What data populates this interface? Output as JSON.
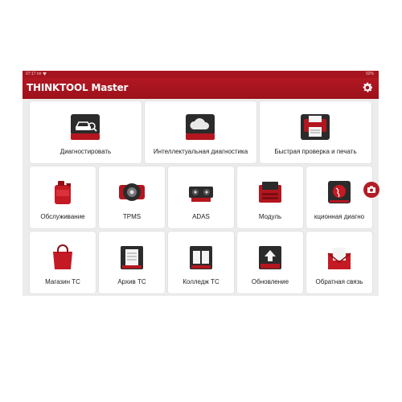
{
  "statusbar": {
    "time": "07:17 пп",
    "battery": "92%"
  },
  "header": {
    "title": "THINKTOOL Master"
  },
  "tiles": [
    {
      "label": "Диагностировать",
      "icon": "car-diagnostic-icon"
    },
    {
      "label": "Интеллектуальная диагностика",
      "icon": "cloud-icon"
    },
    {
      "label": "Быстрая проверка и печать",
      "icon": "printer-icon"
    },
    {
      "label": "Обслуживание",
      "icon": "oil-can-icon"
    },
    {
      "label": "TPMS",
      "icon": "tire-icon"
    },
    {
      "label": "ADAS",
      "icon": "adas-camera-icon"
    },
    {
      "label": "Модуль",
      "icon": "module-icon"
    },
    {
      "label": "кционная диагно",
      "icon": "globe-icon"
    },
    {
      "label": "Магазин ТС",
      "icon": "shopping-bag-icon"
    },
    {
      "label": "Архив ТС",
      "icon": "archive-icon"
    },
    {
      "label": "Колледж ТС",
      "icon": "book-icon"
    },
    {
      "label": "Обновление",
      "icon": "upload-icon"
    },
    {
      "label": "Обратная связь",
      "icon": "envelope-icon"
    }
  ],
  "colors": {
    "brand": "#a6151f",
    "background": "#ececec",
    "tile": "#ffffff"
  }
}
